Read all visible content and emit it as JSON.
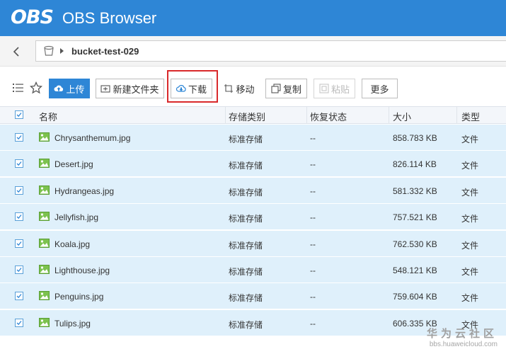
{
  "app": {
    "logo_text": "OBS",
    "title": "OBS Browser"
  },
  "address": {
    "path": "bucket-test-029"
  },
  "toolbar": {
    "upload": "上传",
    "new_folder": "新建文件夹",
    "download": "下载",
    "move": "移动",
    "copy": "复制",
    "paste": "粘贴",
    "more": "更多"
  },
  "table": {
    "headers": {
      "name": "名称",
      "storage": "存储类别",
      "restore": "恢复状态",
      "size": "大小",
      "type": "类型"
    },
    "rows": [
      {
        "name": "Chrysanthemum.jpg",
        "storage": "标准存储",
        "restore": "--",
        "size": "858.783 KB",
        "type": "文件"
      },
      {
        "name": "Desert.jpg",
        "storage": "标准存储",
        "restore": "--",
        "size": "826.114 KB",
        "type": "文件"
      },
      {
        "name": "Hydrangeas.jpg",
        "storage": "标准存储",
        "restore": "--",
        "size": "581.332 KB",
        "type": "文件"
      },
      {
        "name": "Jellyfish.jpg",
        "storage": "标准存储",
        "restore": "--",
        "size": "757.521 KB",
        "type": "文件"
      },
      {
        "name": "Koala.jpg",
        "storage": "标准存储",
        "restore": "--",
        "size": "762.530 KB",
        "type": "文件"
      },
      {
        "name": "Lighthouse.jpg",
        "storage": "标准存储",
        "restore": "--",
        "size": "548.121 KB",
        "type": "文件"
      },
      {
        "name": "Penguins.jpg",
        "storage": "标准存储",
        "restore": "--",
        "size": "759.604 KB",
        "type": "文件"
      },
      {
        "name": "Tulips.jpg",
        "storage": "标准存储",
        "restore": "--",
        "size": "606.335 KB",
        "type": "文件"
      }
    ]
  },
  "watermark": {
    "line1": "华为云社区",
    "line2": "bbs.huaweicloud.com"
  },
  "colors": {
    "brand": "#2e86d6",
    "row_selected": "#dff0fb",
    "highlight": "#d9292b"
  }
}
